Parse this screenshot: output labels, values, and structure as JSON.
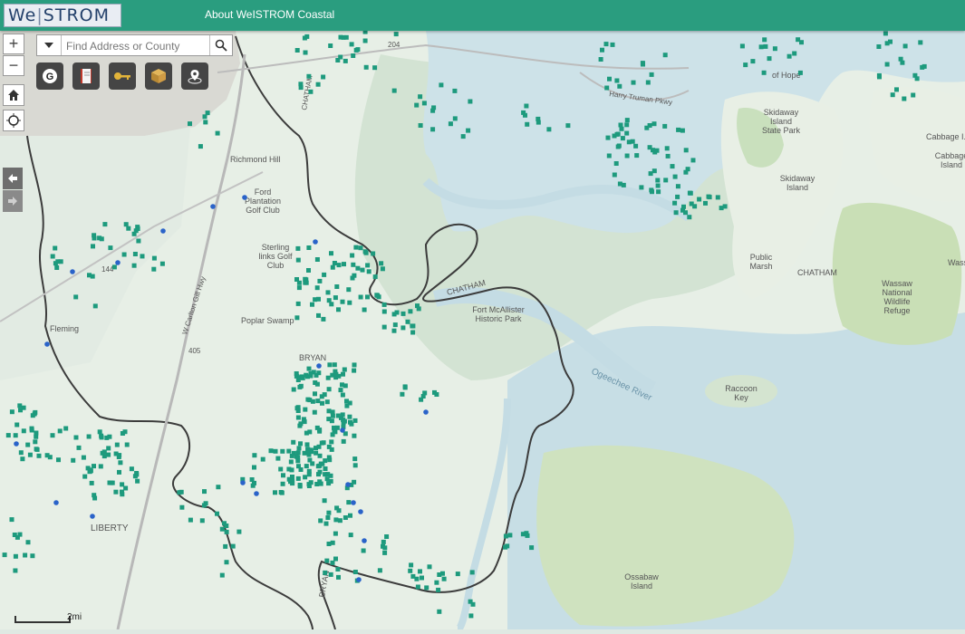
{
  "header": {
    "logo_text_1": "We",
    "logo_text_2": "|",
    "logo_text_3": "STROM",
    "about_link": "About WeISTROM Coastal",
    "bg_color": "#2a9d7f"
  },
  "search": {
    "placeholder": "Find Address or County"
  },
  "zoom": {
    "in_label": "+",
    "out_label": "−"
  },
  "tools": [
    "google-icon",
    "book-icon",
    "key-icon",
    "box-icon",
    "locate-icon"
  ],
  "controls": [
    "home-icon",
    "crosshair-icon",
    "arrow-left-icon",
    "arrow-right-icon"
  ],
  "scale": {
    "label": "2mi"
  },
  "map_labels": {
    "richmond_hill": "Richmond Hill",
    "ford_plantation": "Ford\nPlantation\nGolf Club",
    "sterling_links": "Sterling\nlinks Golf\nClub",
    "poplar_swamp": "Poplar Swamp",
    "chatham_upper": "CHATHAM",
    "chatham_river": "CHATHAM",
    "chatham_right": "CHATHAM",
    "fort_mcallister": "Fort McAllister\nHistoric Park",
    "bryan_mid": "BRYAN",
    "bryan_bottom": "BRYAN",
    "liberty": "LIBERTY",
    "fleming": "Fleming",
    "skidaway_state": "Skidaway\nIsland\nState Park",
    "skidaway_island": "Skidaway\nIsland",
    "cabbage_1": "Cabbage I...",
    "cabbage_2": "Cabbage\nIsland",
    "of_hope": "of Hope",
    "harry_truman": "Harry Truman Pkwy",
    "public_marsh": "Public\nMarsh",
    "wassaw": "Wassaw\nNational\nWildlife\nRefuge",
    "wass": "Wass",
    "ogeechee": "Ogeechee River",
    "raccoon": "Raccoon\nKey",
    "ossabaw": "Ossabaw\nIsland",
    "hwy_204": "204",
    "carlton_gill": "W Carlton Gill Hwy",
    "hwy_144": "144",
    "rt_405": "405"
  },
  "colors": {
    "water": "#c9dfe6",
    "land": "#e7efe6",
    "marsh": "#cfe0cf",
    "park": "#c8dfb8",
    "upland_gray": "#dcdcd6",
    "green_point": "#1d9a7d",
    "blue_point": "#2a63c9",
    "county_line": "#444444"
  }
}
